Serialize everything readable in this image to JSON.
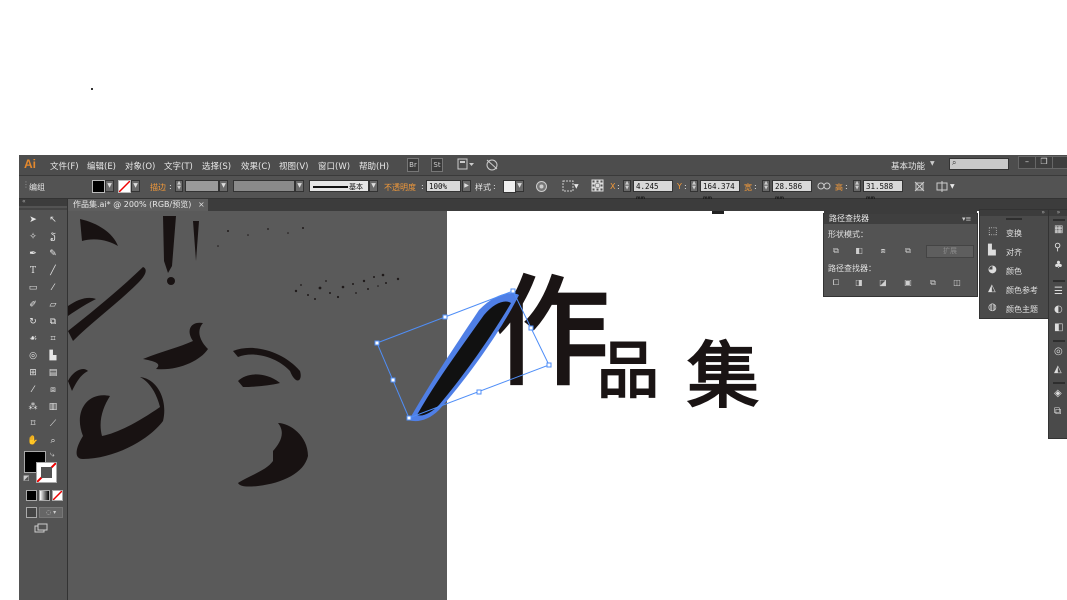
{
  "menubar": {
    "logo": "Ai",
    "items": [
      "文件(F)",
      "编辑(E)",
      "对象(O)",
      "文字(T)",
      "选择(S)",
      "效果(C)",
      "视图(V)",
      "窗口(W)",
      "帮助(H)"
    ],
    "br_badge": "Br",
    "st_badge": "St",
    "workspace_label": "基本功能",
    "search_placeholder": ""
  },
  "controlbar": {
    "selection_label": "编组",
    "stroke_label": "描边",
    "stroke_style_label": "基本",
    "opacity_label": "不透明度",
    "opacity_value": "100%",
    "style_label": "样式",
    "x_label": "X",
    "x_value": "4.245 mm",
    "y_label": "Y",
    "y_value": "164.374 mm",
    "w_label": "宽",
    "w_value": "28.586 mm",
    "h_label": "高",
    "h_value": "31.588 mm"
  },
  "document": {
    "tab_title": "作品集.ai* @ 200% (RGB/预览)",
    "tab_close": "×"
  },
  "artwork": {
    "title_glyph_1": "作",
    "title_glyph_2": "品",
    "title_glyph_3": "集"
  },
  "pathfinder": {
    "title": "路径查找器",
    "shape_modes_label": "形状模式：",
    "expand_label": "扩展",
    "pathfinders_label": "路径查找器："
  },
  "right_panels": {
    "items": [
      "变换",
      "对齐",
      "颜色",
      "颜色参考",
      "颜色主题"
    ]
  },
  "colors": {
    "app_bg": "#4b4b4b",
    "selection_blue": "#4f8ef7",
    "logo_orange": "#e5892d",
    "ink": "#1a1414"
  }
}
